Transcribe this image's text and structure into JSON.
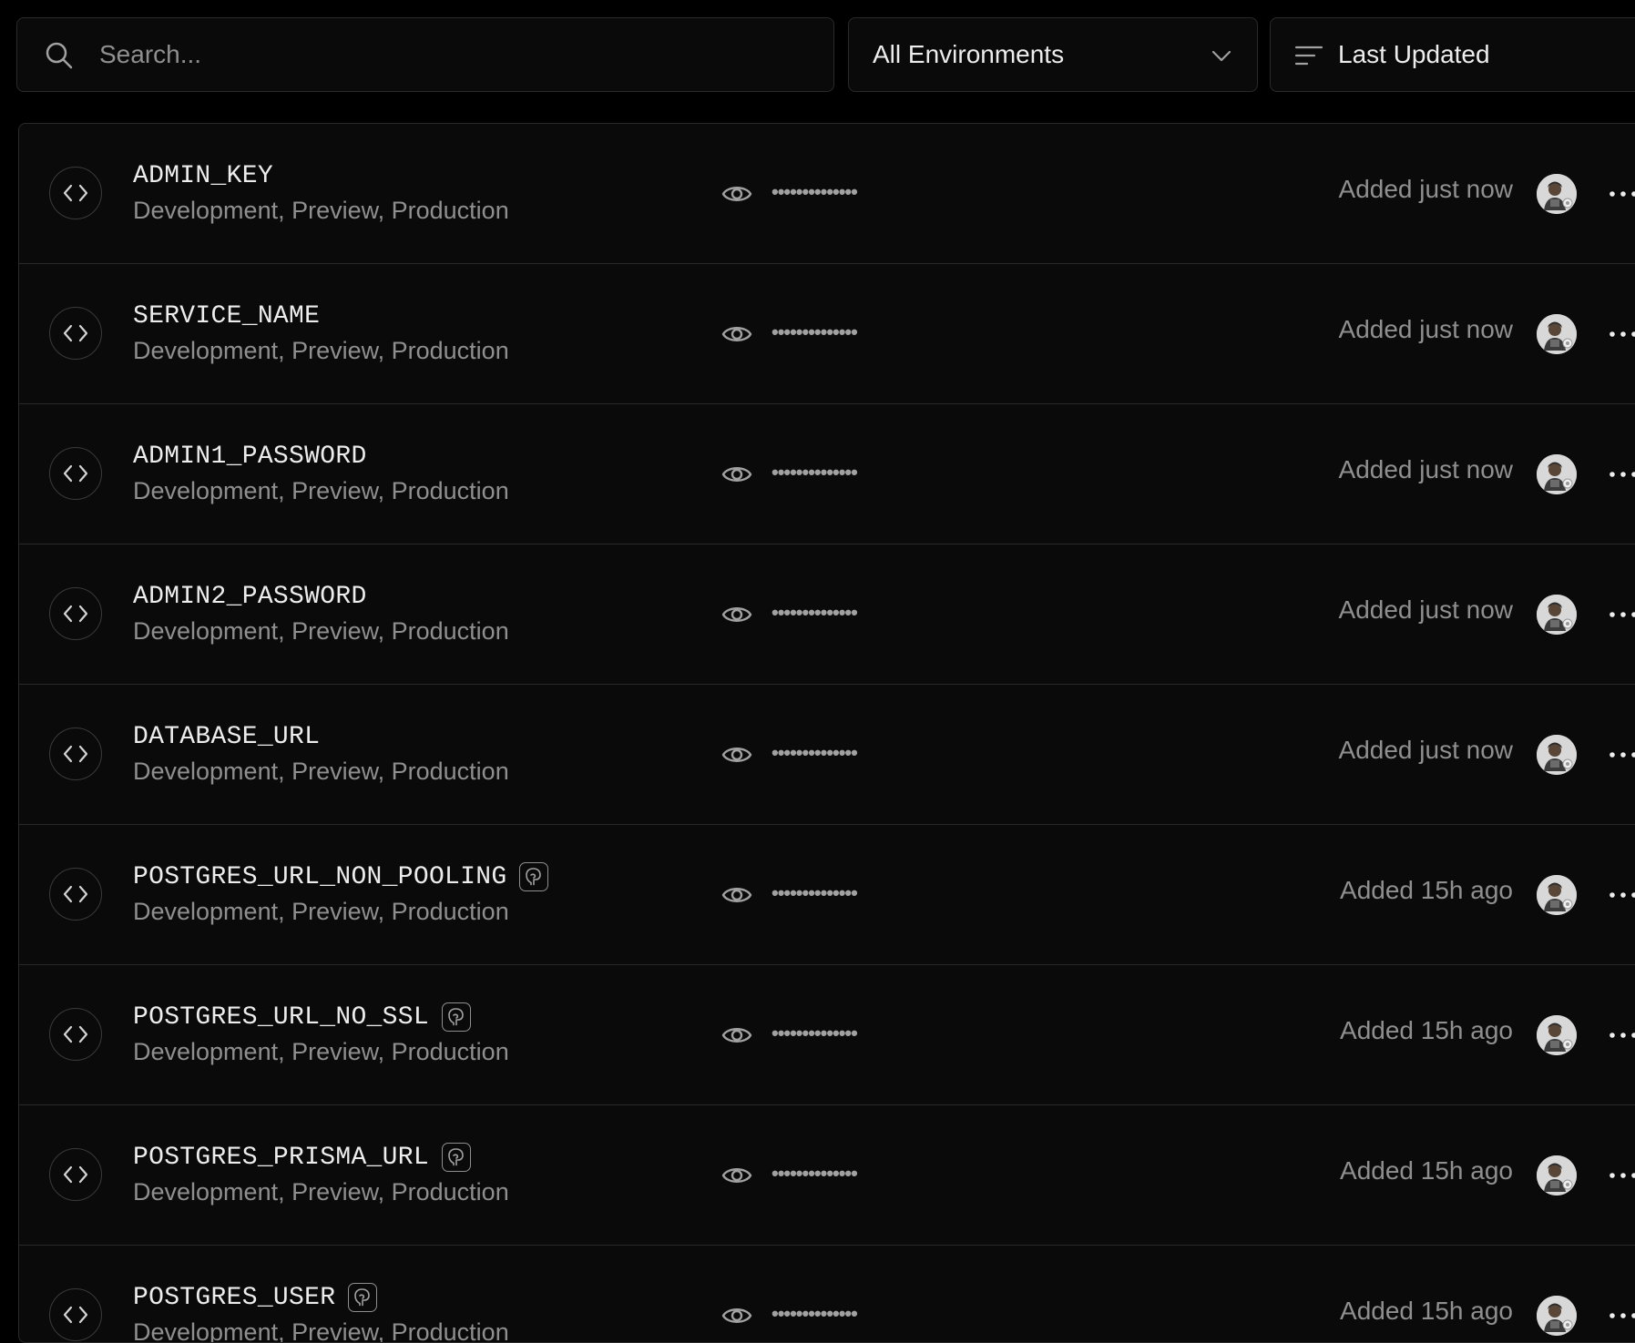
{
  "toolbar": {
    "search_placeholder": "Search...",
    "search_icon": "search-icon",
    "environment_filter": "All Environments",
    "sort_label": "Last Updated",
    "sort_icon": "sort-lines-icon"
  },
  "colors": {
    "background": "#000000",
    "panel": "#0a0a0a",
    "border": "#2a2a2a",
    "text_primary": "#ededed",
    "text_secondary": "#8f8f8f"
  },
  "variables": [
    {
      "name": "ADMIN_KEY",
      "environments": "Development, Preview, Production",
      "masked_value": "••••••••••••••",
      "added": "Added just now",
      "integration": false
    },
    {
      "name": "SERVICE_NAME",
      "environments": "Development, Preview, Production",
      "masked_value": "••••••••••••••",
      "added": "Added just now",
      "integration": false
    },
    {
      "name": "ADMIN1_PASSWORD",
      "environments": "Development, Preview, Production",
      "masked_value": "••••••••••••••",
      "added": "Added just now",
      "integration": false
    },
    {
      "name": "ADMIN2_PASSWORD",
      "environments": "Development, Preview, Production",
      "masked_value": "••••••••••••••",
      "added": "Added just now",
      "integration": false
    },
    {
      "name": "DATABASE_URL",
      "environments": "Development, Preview, Production",
      "masked_value": "••••••••••••••",
      "added": "Added just now",
      "integration": false
    },
    {
      "name": "POSTGRES_URL_NON_POOLING",
      "environments": "Development, Preview, Production",
      "masked_value": "••••••••••••••",
      "added": "Added 15h ago",
      "integration": true
    },
    {
      "name": "POSTGRES_URL_NO_SSL",
      "environments": "Development, Preview, Production",
      "masked_value": "••••••••••••••",
      "added": "Added 15h ago",
      "integration": true
    },
    {
      "name": "POSTGRES_PRISMA_URL",
      "environments": "Development, Preview, Production",
      "masked_value": "••••••••••••••",
      "added": "Added 15h ago",
      "integration": true
    },
    {
      "name": "POSTGRES_USER",
      "environments": "Development, Preview, Production",
      "masked_value": "••••••••••••••",
      "added": "Added 15h ago",
      "integration": true
    }
  ]
}
